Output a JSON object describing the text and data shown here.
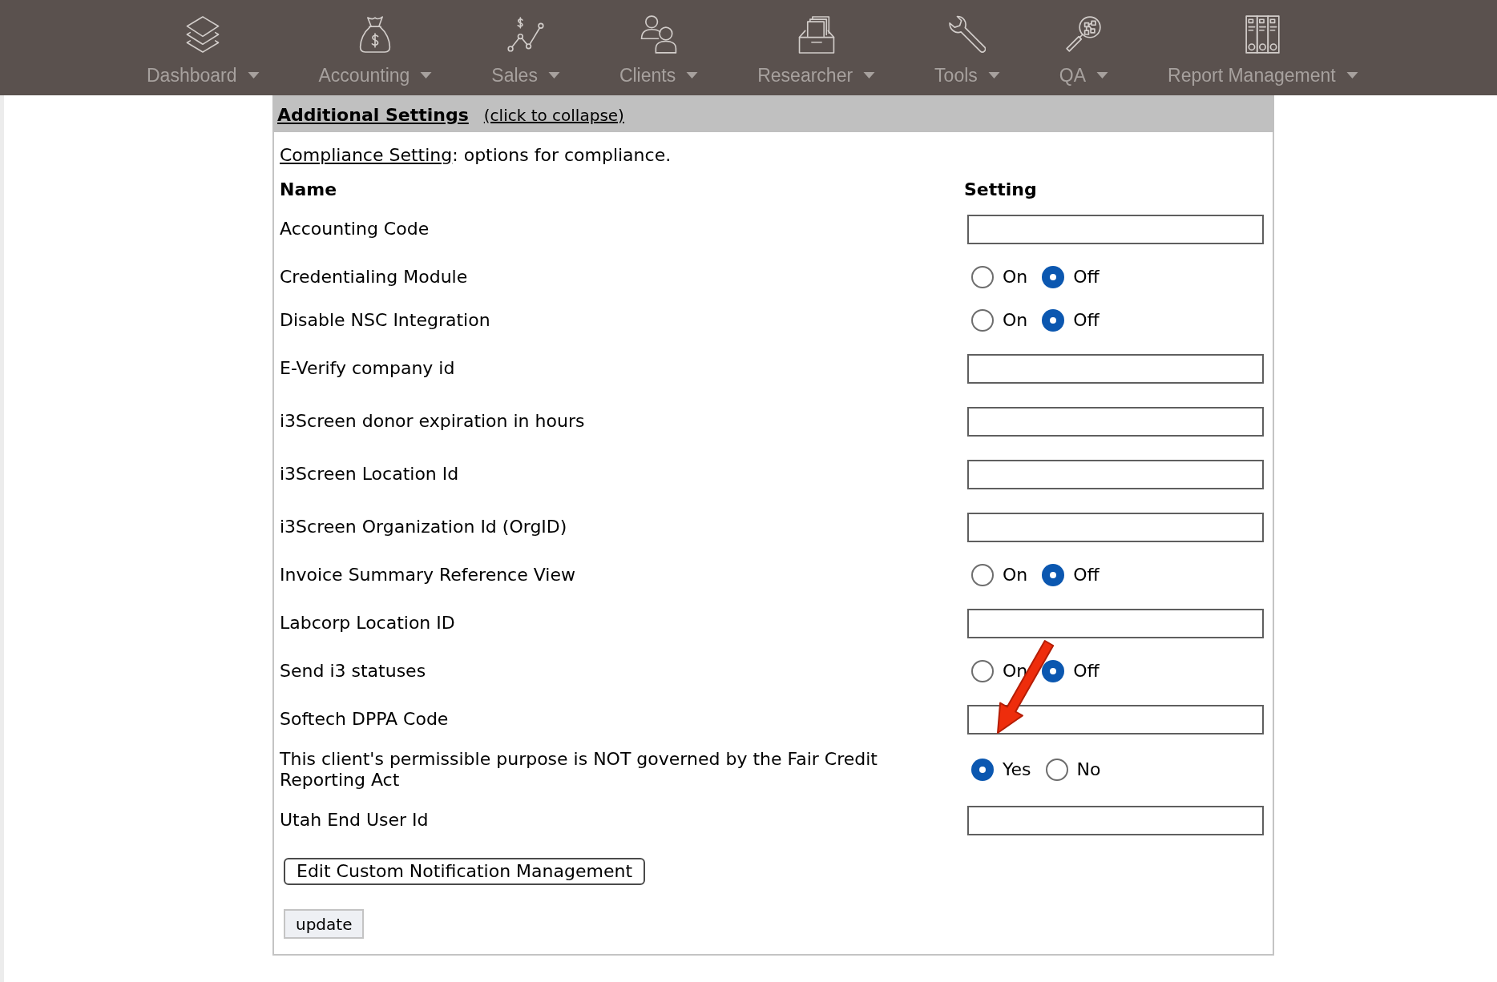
{
  "nav": [
    {
      "label": "Dashboard"
    },
    {
      "label": "Accounting"
    },
    {
      "label": "Sales"
    },
    {
      "label": "Clients"
    },
    {
      "label": "Researcher"
    },
    {
      "label": "Tools"
    },
    {
      "label": "QA"
    },
    {
      "label": "Report Management"
    }
  ],
  "panel": {
    "title": "Additional Settings",
    "toggle": "(click to collapse)",
    "section": {
      "link": "Compliance Setting",
      "text": ": options for compliance."
    },
    "columns": [
      "Name",
      "Setting"
    ],
    "settings": [
      {
        "name": "Accounting Code",
        "kind": "text"
      },
      {
        "name": "Credentialing Module",
        "kind": "radio",
        "options": [
          {
            "label": "On",
            "selected": false
          },
          {
            "label": "Off",
            "selected": true
          }
        ]
      },
      {
        "name": "Disable NSC Integration",
        "kind": "radio",
        "options": [
          {
            "label": "On",
            "selected": false
          },
          {
            "label": "Off",
            "selected": true
          }
        ]
      },
      {
        "name": "E-Verify company id",
        "kind": "text"
      },
      {
        "name": "i3Screen donor expiration in hours",
        "kind": "text"
      },
      {
        "name": "i3Screen Location Id",
        "kind": "text"
      },
      {
        "name": "i3Screen Organization Id (OrgID)",
        "kind": "text"
      },
      {
        "name": "Invoice Summary Reference View",
        "kind": "radio",
        "options": [
          {
            "label": "On",
            "selected": false
          },
          {
            "label": "Off",
            "selected": true
          }
        ]
      },
      {
        "name": "Labcorp Location ID",
        "kind": "text"
      },
      {
        "name": "Send i3 statuses",
        "kind": "radio",
        "options": [
          {
            "label": "On",
            "selected": false
          },
          {
            "label": "Off",
            "selected": true
          }
        ]
      },
      {
        "name": "Softech DPPA Code",
        "kind": "text"
      },
      {
        "name": "This client's permissible purpose is NOT governed by the Fair Credit Reporting Act",
        "kind": "radio",
        "options": [
          {
            "label": "Yes",
            "selected": true
          },
          {
            "label": "No",
            "selected": false
          }
        ]
      },
      {
        "name": "Utah End User Id",
        "kind": "text"
      }
    ],
    "buttons": [
      {
        "label": "Edit Custom Notification Management",
        "kind": "outline"
      },
      {
        "label": "update",
        "kind": "submit"
      }
    ]
  }
}
